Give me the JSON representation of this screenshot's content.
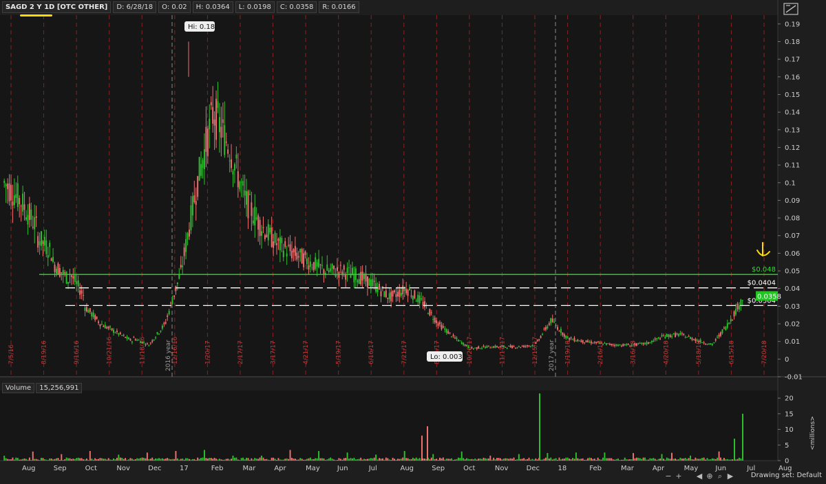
{
  "header": {
    "symbol": "SAGD 2 Y 1D [OTC OTHER]",
    "date": "D: 6/28/18",
    "open": "O: 0.02",
    "high": "H: 0.0364",
    "low": "L: 0.0198",
    "close": "C: 0.0358",
    "range": "R: 0.0166"
  },
  "volume_header": {
    "label": "Volume",
    "value": "15,256,991"
  },
  "footer": {
    "drawing_set": "Drawing set: Default"
  },
  "colors": {
    "up": "#2cc12c",
    "down": "#f07070",
    "support": "#3bd13b",
    "background": "#1e1e1e",
    "annotation": "#ffe000"
  },
  "chart_data": {
    "type": "candlestick",
    "price_axis": {
      "ylim": [
        -0.01,
        0.195
      ],
      "ticks": [
        "0.19",
        "0.18",
        "0.17",
        "0.16",
        "0.15",
        "0.14",
        "0.13",
        "0.12",
        "0.11",
        "0.1",
        "0.09",
        "0.08",
        "0.07",
        "0.06",
        "0.05",
        "0.04",
        "0.03",
        "0.02",
        "0.01",
        "0",
        "-0.01"
      ]
    },
    "volume_axis": {
      "label": "<millions>",
      "ylim": [
        0,
        22
      ],
      "ticks": [
        "20",
        "15",
        "10",
        "5",
        "0"
      ]
    },
    "months": [
      "Aug",
      "Sep",
      "Oct",
      "Nov",
      "Dec",
      "17",
      "Feb",
      "Mar",
      "Apr",
      "May",
      "Jun",
      "Jul",
      "Aug",
      "Sep",
      "Oct",
      "Nov",
      "Dec",
      "18",
      "Feb",
      "Mar",
      "Apr",
      "May",
      "Jun",
      "Jul",
      "Aug"
    ],
    "event_dates": [
      "7/5/16",
      "8/19/16",
      "9/16/16",
      "10/21/16",
      "11/18/16",
      "12/16/16",
      "1/20/17",
      "2/17/17",
      "3/17/17",
      "4/21/17",
      "5/19/17",
      "6/16/17",
      "7/21/17",
      "8/18/17",
      "10/20/17",
      "11/17/17",
      "12/15/17",
      "1/19/18",
      "2/16/18",
      "3/16/18",
      "4/20/18",
      "5/18/18",
      "6/15/18",
      "7/20/18"
    ],
    "year_markers": [
      "2016 year",
      "2017 year"
    ],
    "high_label": "Hi: 0.18",
    "low_label": "Lo: 0.0033",
    "levels": [
      {
        "label": "$0.048",
        "value": 0.048,
        "style": "solid",
        "color": "#3bd13b"
      },
      {
        "label": "$0.0404",
        "value": 0.0404,
        "style": "dashed",
        "color": "#ffffff"
      },
      {
        "label": "$0.0304",
        "value": 0.0304,
        "style": "dashed",
        "color": "#ffffff"
      }
    ],
    "last_price": "0.0358",
    "price_path": [
      [
        0.1,
        0.09
      ],
      [
        0.09,
        0.075
      ],
      [
        0.07,
        0.06
      ],
      [
        0.055,
        0.045
      ],
      [
        0.05,
        0.035
      ],
      [
        0.03,
        0.02
      ],
      [
        0.02,
        0.015
      ],
      [
        0.015,
        0.01
      ],
      [
        0.012,
        0.008
      ],
      [
        0.008,
        0.02
      ],
      [
        0.02,
        0.05
      ],
      [
        0.05,
        0.1
      ],
      [
        0.1,
        0.14
      ],
      [
        0.14,
        0.12
      ],
      [
        0.12,
        0.09
      ],
      [
        0.09,
        0.075
      ],
      [
        0.075,
        0.065
      ],
      [
        0.065,
        0.06
      ],
      [
        0.06,
        0.055
      ],
      [
        0.055,
        0.05
      ],
      [
        0.05,
        0.05
      ],
      [
        0.05,
        0.047
      ],
      [
        0.047,
        0.042
      ],
      [
        0.042,
        0.035
      ],
      [
        0.035,
        0.04
      ],
      [
        0.04,
        0.032
      ],
      [
        0.032,
        0.02
      ],
      [
        0.02,
        0.012
      ],
      [
        0.012,
        0.006
      ],
      [
        0.006,
        0.007
      ],
      [
        0.007,
        0.007
      ],
      [
        0.007,
        0.007
      ],
      [
        0.007,
        0.008
      ],
      [
        0.008,
        0.022
      ],
      [
        0.022,
        0.012
      ],
      [
        0.012,
        0.01
      ],
      [
        0.01,
        0.009
      ],
      [
        0.009,
        0.008
      ],
      [
        0.008,
        0.008
      ],
      [
        0.008,
        0.009
      ],
      [
        0.009,
        0.013
      ],
      [
        0.013,
        0.014
      ],
      [
        0.014,
        0.011
      ],
      [
        0.011,
        0.008
      ],
      [
        0.008,
        0.02
      ],
      [
        0.02,
        0.0358
      ]
    ]
  }
}
